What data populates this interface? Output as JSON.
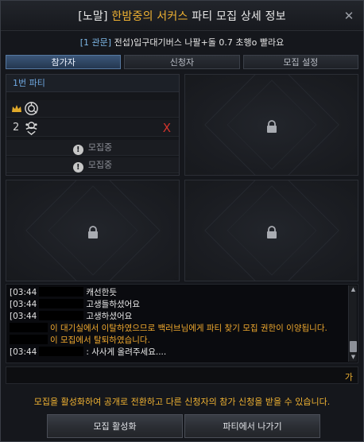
{
  "window": {
    "title_prefix": "[노말]",
    "title_accent": "한밤중의 서커스",
    "title_suffix": "파티 모집 상세 정보",
    "close_label": "✕"
  },
  "subtitle": {
    "channel": "[1 관문]",
    "text": "전섭)입구대기버스 나팔+돌 0.7 초행o 빨라요"
  },
  "tabs": [
    {
      "label": "참가자",
      "active": true
    },
    {
      "label": "신청자",
      "active": false
    },
    {
      "label": "모집 설정",
      "active": false
    }
  ],
  "party": {
    "header": "1번 파티",
    "members": [
      {
        "number": "",
        "leader": true,
        "icon": "class-emblem-icon",
        "kickable": false
      },
      {
        "number": "2",
        "leader": false,
        "icon": "class-emblem-icon",
        "kickable": true,
        "kick_label": "X"
      }
    ],
    "recruiting": [
      {
        "label": "모집중"
      },
      {
        "label": "모집중"
      }
    ]
  },
  "locked_slots": 3,
  "chat": {
    "lines": [
      {
        "type": "user",
        "time": "[03:44",
        "text": "캐선한듯"
      },
      {
        "type": "user",
        "time": "[03:44",
        "text": "고생들하셨어요"
      },
      {
        "type": "user",
        "time": "[03:44",
        "text": "고생하셨어요"
      },
      {
        "type": "system",
        "text": "이 대기실에서 이탈하였으므로 백러브님에게 파티 찾기 모집 권한이 이양됩니다."
      },
      {
        "type": "system",
        "text": "이 모집에서 탈퇴하였습니다."
      },
      {
        "type": "user",
        "time": "[03:44",
        "text": ": 사사게 올려주세요...."
      }
    ],
    "input_lang": "가"
  },
  "notice": "모집을 활성화하여 공개로 전환하고 다른 신청자의 참가 신청을 받을 수 있습니다.",
  "buttons": {
    "activate": "모집 활성화",
    "leave": "파티에서 나가기"
  },
  "colors": {
    "accent": "#f0b232",
    "channel": "#7db7e6",
    "party_header": "#6ea7e0",
    "kick": "#d1342c",
    "system_msg": "#f0a92e"
  }
}
